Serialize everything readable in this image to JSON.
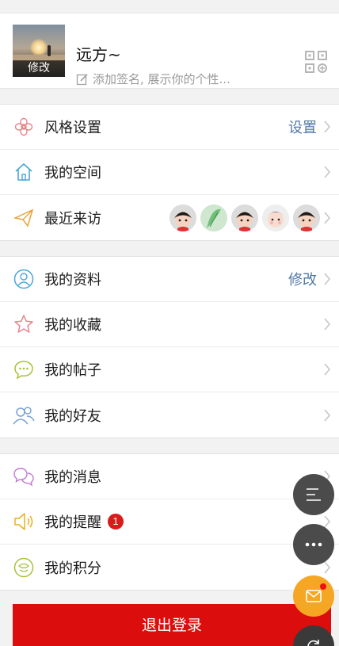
{
  "profile": {
    "avatar_edit": "修改",
    "nickname": "远方~",
    "signature_placeholder": "添加签名, 展示你的个性..."
  },
  "group1": {
    "style_label": "风格设置",
    "style_action": "设置",
    "space_label": "我的空间",
    "visitors_label": "最近来访"
  },
  "group2": {
    "info_label": "我的资料",
    "info_action": "修改",
    "favorites_label": "我的收藏",
    "posts_label": "我的帖子",
    "friends_label": "我的好友"
  },
  "group3": {
    "messages_label": "我的消息",
    "reminders_label": "我的提醒",
    "reminders_badge": "1",
    "points_label": "我的积分"
  },
  "logout_label": "退出登录",
  "colors": {
    "logout_red": "#dc0d0d",
    "link_blue": "#4f78a8",
    "badge_red": "#d81b1b",
    "fab_orange": "#f5a623"
  }
}
